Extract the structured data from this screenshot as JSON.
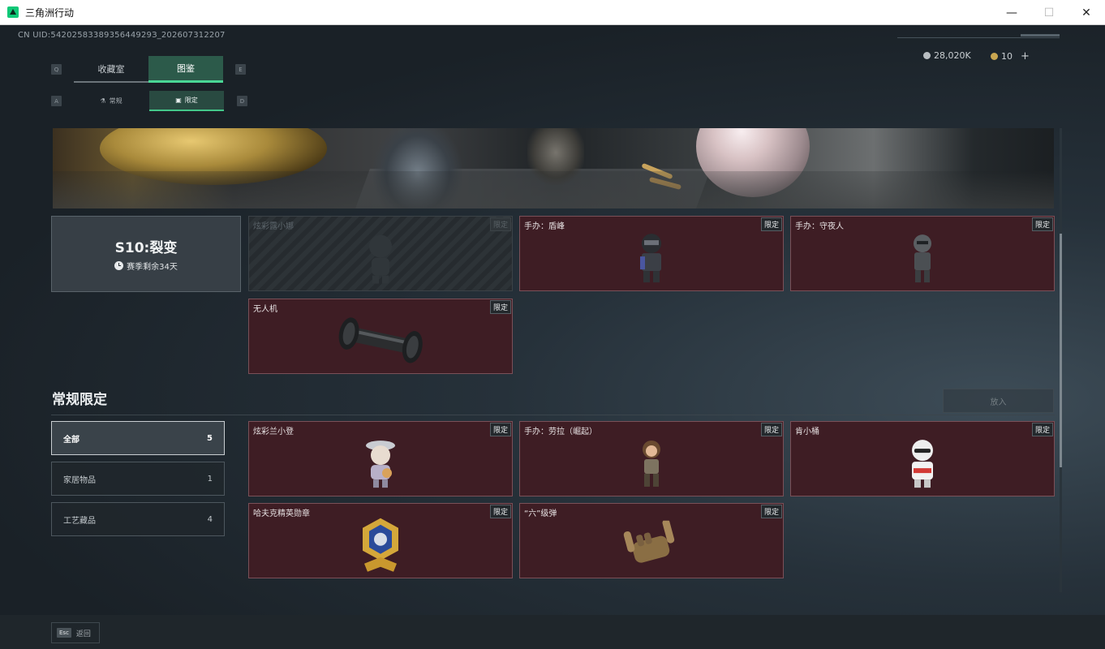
{
  "window": {
    "title": "三角洲行动",
    "logo": "delta-logo-icon",
    "minimize": "—",
    "maximize": "☐",
    "close": "✕"
  },
  "header": {
    "uid": "CN UID:5420258338935644929З_202607312207",
    "silver_amount": "28,020K",
    "gold_amount": "10",
    "gold_add": "+",
    "colors": {
      "accent": "#49d795",
      "card_bg": "#3e1d24"
    }
  },
  "tabs": {
    "key_left": "Q",
    "key_right": "E",
    "items": [
      {
        "label": "收藏室"
      },
      {
        "label": "图鉴"
      }
    ]
  },
  "subtabs": {
    "key_left": "A",
    "key_right": "D",
    "items": [
      {
        "label": "常规",
        "icon": "flask-icon"
      },
      {
        "label": "限定",
        "icon": "image-icon"
      }
    ]
  },
  "season": {
    "title": "S10:裂变",
    "remaining": "赛季剩余34天"
  },
  "season_items": [
    {
      "name": "炫彩露小娜",
      "badge": "限定",
      "locked": true
    },
    {
      "name": "手办：盾峰",
      "badge": "限定"
    },
    {
      "name": "手办：守夜人",
      "badge": "限定"
    },
    {
      "name": "无人机",
      "badge": "限定"
    }
  ],
  "regular": {
    "title": "常规限定",
    "put_button": "放入",
    "filters": [
      {
        "label": "全部",
        "count": "5"
      },
      {
        "label": "家居物品",
        "count": "1"
      },
      {
        "label": "工艺藏品",
        "count": "4"
      }
    ],
    "items": [
      {
        "name": "炫彩兰小登",
        "badge": "限定"
      },
      {
        "name": "手办：劳拉（崛起）",
        "badge": "限定"
      },
      {
        "name": "肯小桶",
        "badge": "限定"
      },
      {
        "name": "哈夫克精英勋章",
        "badge": "限定"
      },
      {
        "name": "“六”级弹",
        "badge": "限定"
      }
    ]
  },
  "footer": {
    "esc_key": "Esc",
    "back_label": "返回"
  }
}
